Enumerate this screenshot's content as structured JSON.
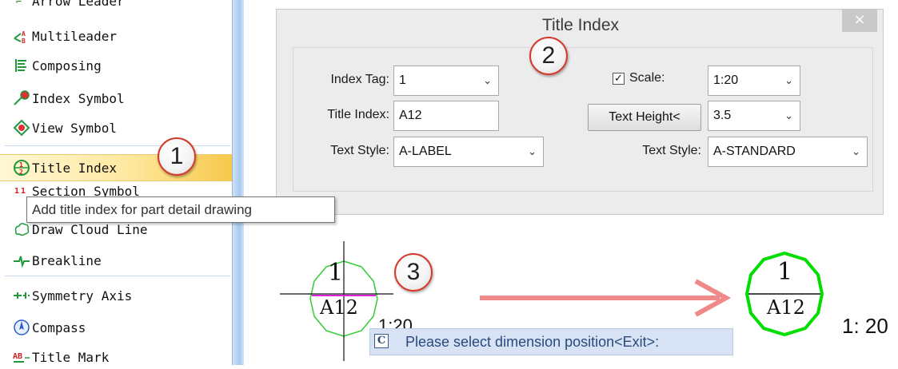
{
  "menu": {
    "items": [
      {
        "label": "Arrow Leader",
        "icon": "arrow-leader-icon"
      },
      {
        "label": "Multileader",
        "icon": "multileader-icon"
      },
      {
        "label": "Composing",
        "icon": "composing-icon"
      },
      {
        "label": "Index Symbol",
        "icon": "index-symbol-icon"
      },
      {
        "label": "View Symbol",
        "icon": "view-symbol-icon"
      },
      {
        "label": "Title Index",
        "icon": "title-index-icon",
        "selected": true
      },
      {
        "label": "Section Symbol",
        "icon": "section-symbol-icon"
      },
      {
        "label": "Draw Cloud Line",
        "icon": "cloud-line-icon"
      },
      {
        "label": "Breakline",
        "icon": "breakline-icon"
      },
      {
        "label": "Symmetry Axis",
        "icon": "symmetry-axis-icon"
      },
      {
        "label": "Compass",
        "icon": "compass-icon"
      },
      {
        "label": "Title Mark",
        "icon": "title-mark-icon"
      }
    ],
    "tooltip": "Add title index for part detail drawing"
  },
  "dialog": {
    "title": "Title Index",
    "close_label": "×",
    "index_tag": {
      "label": "Index Tag:",
      "value": "1"
    },
    "scale": {
      "label": "Scale:",
      "checked": true,
      "value": "1:20"
    },
    "title_index": {
      "label": "Title Index:",
      "value": "A12"
    },
    "text_height": {
      "button_label": "Text Height<",
      "value": "3.5"
    },
    "text_style_left": {
      "label": "Text Style:",
      "value": "A-LABEL"
    },
    "text_style_right": {
      "label": "Text Style:",
      "value": "A-STANDARD"
    }
  },
  "steps": [
    "1",
    "2",
    "3"
  ],
  "drawing": {
    "before": {
      "top": "1",
      "bottom": "A12",
      "scale_partial": "1:20"
    },
    "after": {
      "top": "1",
      "bottom": "A12",
      "scale": "1: 20"
    },
    "command_prompt": "Please select dimension position<Exit>:",
    "command_icon": "C"
  },
  "colors": {
    "selection_highlight": "#f7c94a",
    "step_ring": "#d33a2a",
    "arrow": "#ef8a8a",
    "circle_before": "#33cc33",
    "circle_after": "#00dd00",
    "divider_before": "#dd22dd",
    "command_bg": "#d7e3f4"
  }
}
